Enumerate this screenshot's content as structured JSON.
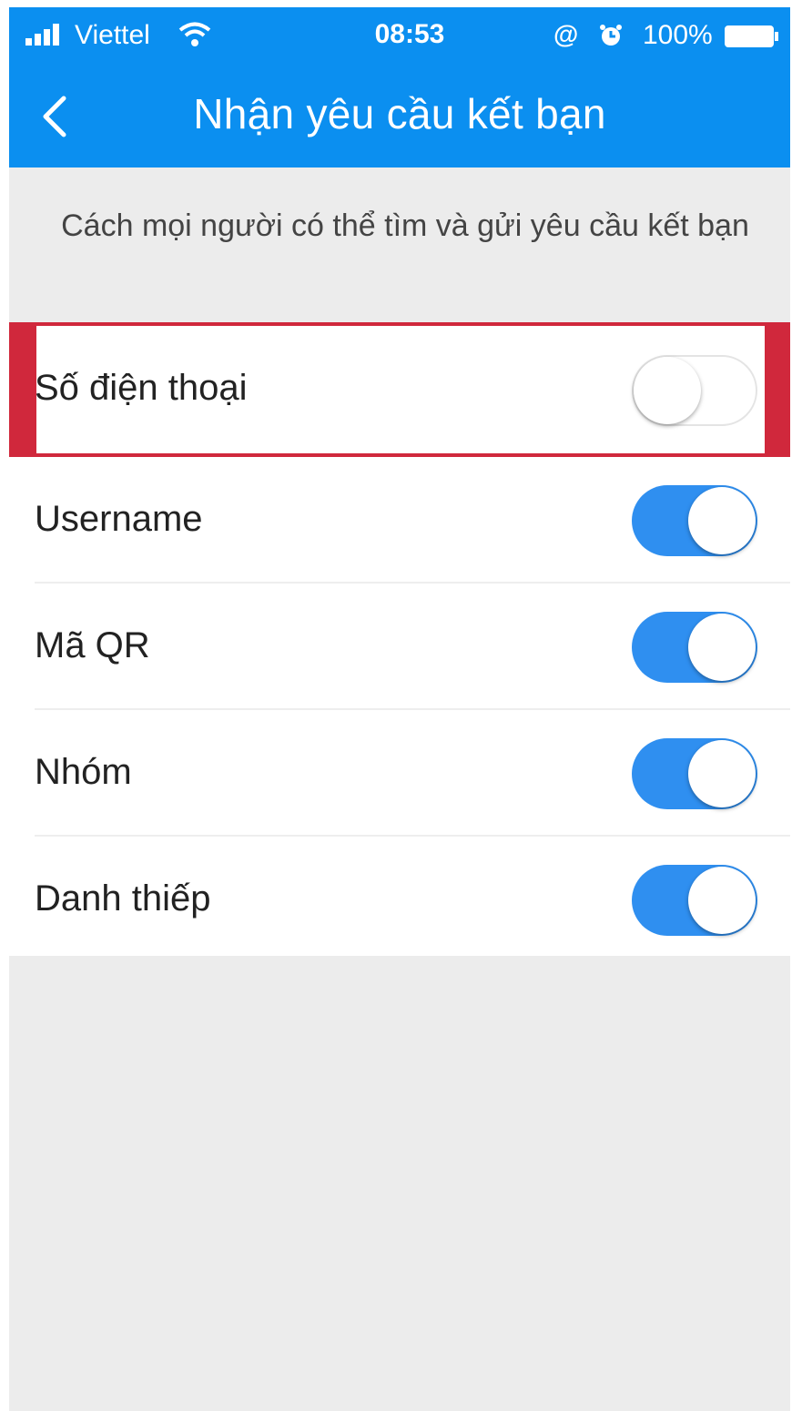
{
  "status_bar": {
    "carrier": "Viettel",
    "time": "08:53",
    "battery": "100%",
    "icons": [
      "signal-icon",
      "wifi-icon",
      "at-icon",
      "alarm-icon",
      "battery-icon"
    ]
  },
  "nav": {
    "title": "Nhận yêu cầu kết bạn",
    "back_icon": "chevron-left-icon"
  },
  "description": "Cách mọi người có thể tìm và gửi yêu cầu kết bạn",
  "settings": [
    {
      "label": "Số điện thoại",
      "enabled": false,
      "highlighted": true
    },
    {
      "label": "Username",
      "enabled": true
    },
    {
      "label": "Mã QR",
      "enabled": true
    },
    {
      "label": "Nhóm",
      "enabled": true
    },
    {
      "label": "Danh thiếp",
      "enabled": true
    }
  ],
  "colors": {
    "header": "#0b8ff0",
    "toggle_on": "#2f8ff0",
    "highlight": "#d0283c",
    "background": "#ececec"
  }
}
